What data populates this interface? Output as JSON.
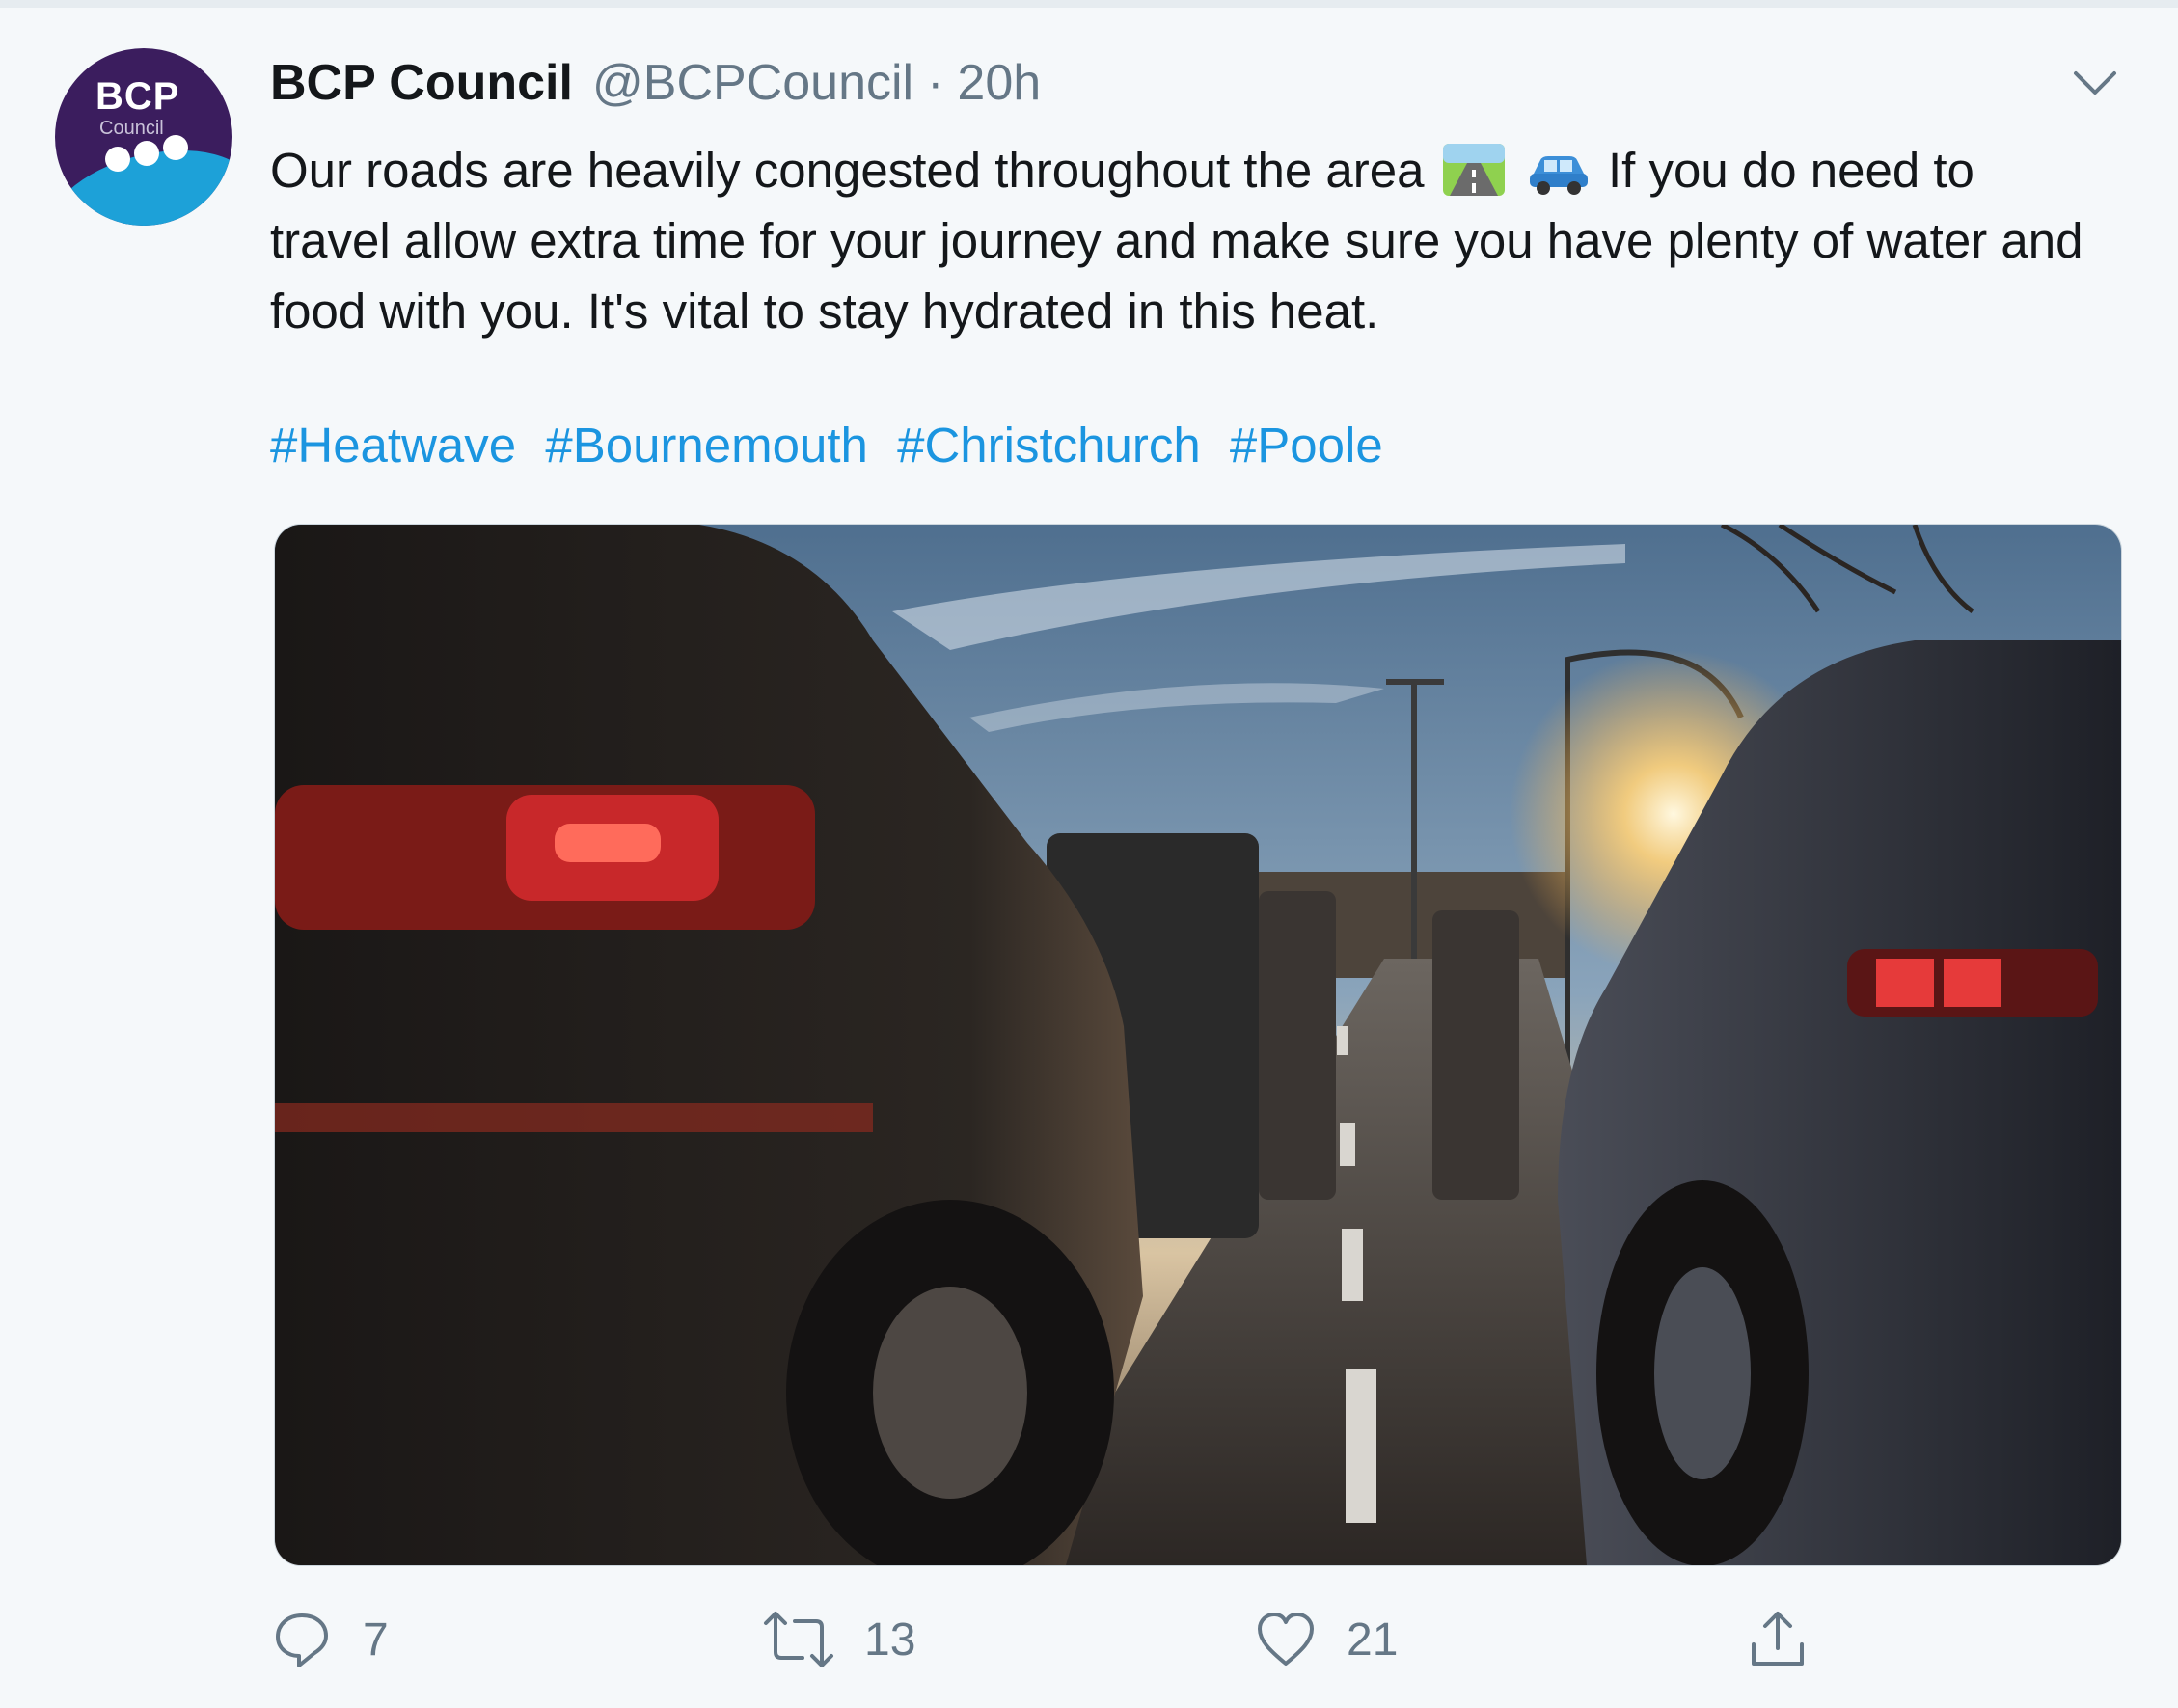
{
  "tweet": {
    "author_name": "BCP Council",
    "author_handle": "@BCPCouncil",
    "separator": "·",
    "time": "20h",
    "avatar": {
      "title": "BCP",
      "subtitle": "Council"
    },
    "text_before_emoji": "Our roads are heavily congested throughout the area",
    "emojis": [
      "motorway-emoji",
      "car-emoji"
    ],
    "text_after_emoji": "If you do need to travel allow extra time for your journey and make sure you have plenty of water and food with you. It's vital to stay hydrated in this heat.",
    "hashtags": [
      "#Heatwave",
      "#Bournemouth",
      "#Christchurch",
      "#Poole"
    ],
    "media": {
      "kind": "photo"
    }
  },
  "actions": {
    "reply": {
      "icon": "reply-icon",
      "count": "7"
    },
    "retweet": {
      "icon": "retweet-icon",
      "count": "13"
    },
    "like": {
      "icon": "heart-icon",
      "count": "21"
    },
    "share": {
      "icon": "share-icon"
    }
  },
  "colors": {
    "background": "#f5f8fa",
    "text": "#14171a",
    "secondary": "#657786",
    "link": "#1b95e0"
  }
}
